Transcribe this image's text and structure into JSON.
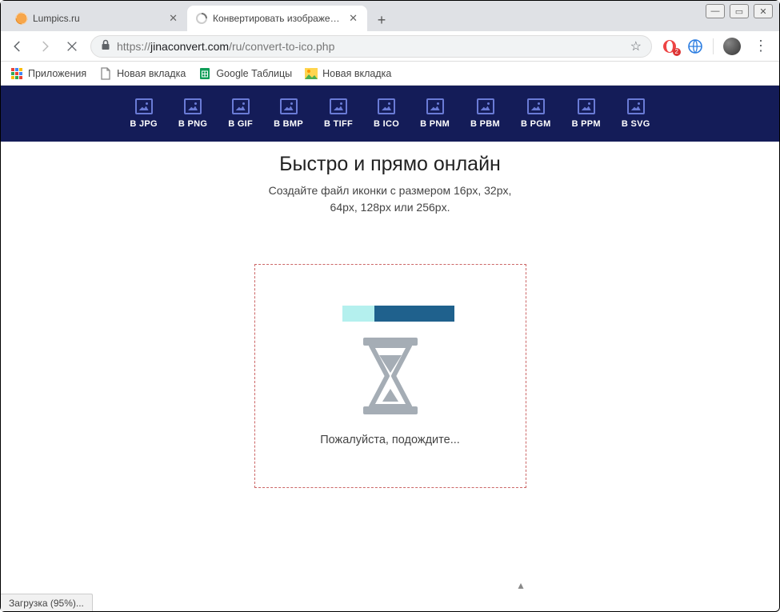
{
  "window": {
    "minimize": "—",
    "maximize": "▭",
    "close": "✕"
  },
  "tabs": [
    {
      "title": "Lumpics.ru",
      "active": false
    },
    {
      "title": "Конвертировать изображения в",
      "active": true
    }
  ],
  "addressbar": {
    "url_scheme": "https://",
    "url_domain": "jinaconvert.com",
    "url_path": "/ru/convert-to-ico.php",
    "ext_badge": "2"
  },
  "bookmarks": [
    {
      "label": "Приложения",
      "icon": "apps"
    },
    {
      "label": "Новая вкладка",
      "icon": "page"
    },
    {
      "label": "Google Таблицы",
      "icon": "sheets"
    },
    {
      "label": "Новая вкладка",
      "icon": "pic"
    }
  ],
  "formats": [
    "В JPG",
    "В PNG",
    "В GIF",
    "В BMP",
    "В TIFF",
    "В ICO",
    "В PNM",
    "В PBM",
    "В PGM",
    "В PPM",
    "В SVG"
  ],
  "page": {
    "headline": "Быстро и прямо онлайн",
    "subhead_line1": "Создайте файл иконки с размером 16px, 32px,",
    "subhead_line2": "64px, 128px или 256px.",
    "wait_text": "Пожалуйста, подождите..."
  },
  "status": {
    "text": "Загрузка (95%)..."
  }
}
